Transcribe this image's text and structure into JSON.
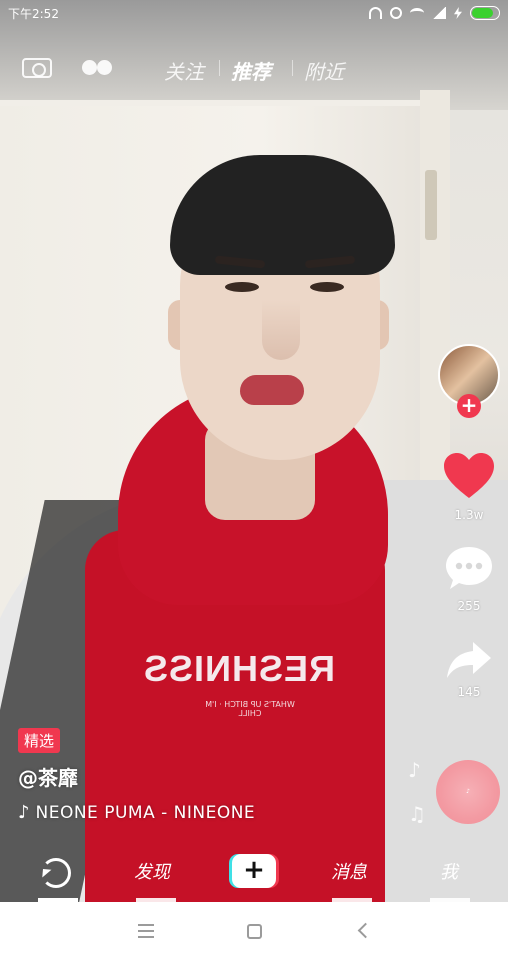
{
  "status_bar": {
    "time": "下午2:52",
    "icons": [
      "headphone-icon",
      "alarm-icon",
      "wifi-icon",
      "signal-icon",
      "charging-icon",
      "battery-icon"
    ],
    "battery_color": "#3bd12f"
  },
  "top_nav": {
    "left_icons": [
      "camera-icon",
      "duet-dots-icon"
    ],
    "tabs": [
      {
        "label": "关注",
        "active": false
      },
      {
        "label": "推荐",
        "active": true
      },
      {
        "label": "附近",
        "active": false
      }
    ]
  },
  "video": {
    "shirt_print": "RESHNISS",
    "shirt_subprint": "WHAT'S UP BITCH · I'M CHILL"
  },
  "actions": {
    "follow_label": "+",
    "like_count": "1.3w",
    "comment_count": "255",
    "share_count": "145",
    "accent_color": "#f0384f"
  },
  "post": {
    "badge": "精选",
    "username": "@茶靡",
    "music": "NEONE   PUMA - NINEONE"
  },
  "bottom_nav": {
    "items": [
      {
        "label": "refresh",
        "icon": "refresh-icon"
      },
      {
        "label": "发现"
      },
      {
        "label": "+",
        "icon": "plus-icon"
      },
      {
        "label": "消息"
      },
      {
        "label": "我"
      }
    ]
  },
  "system_nav": {
    "buttons": [
      "menu-icon",
      "home-icon",
      "back-icon"
    ]
  }
}
